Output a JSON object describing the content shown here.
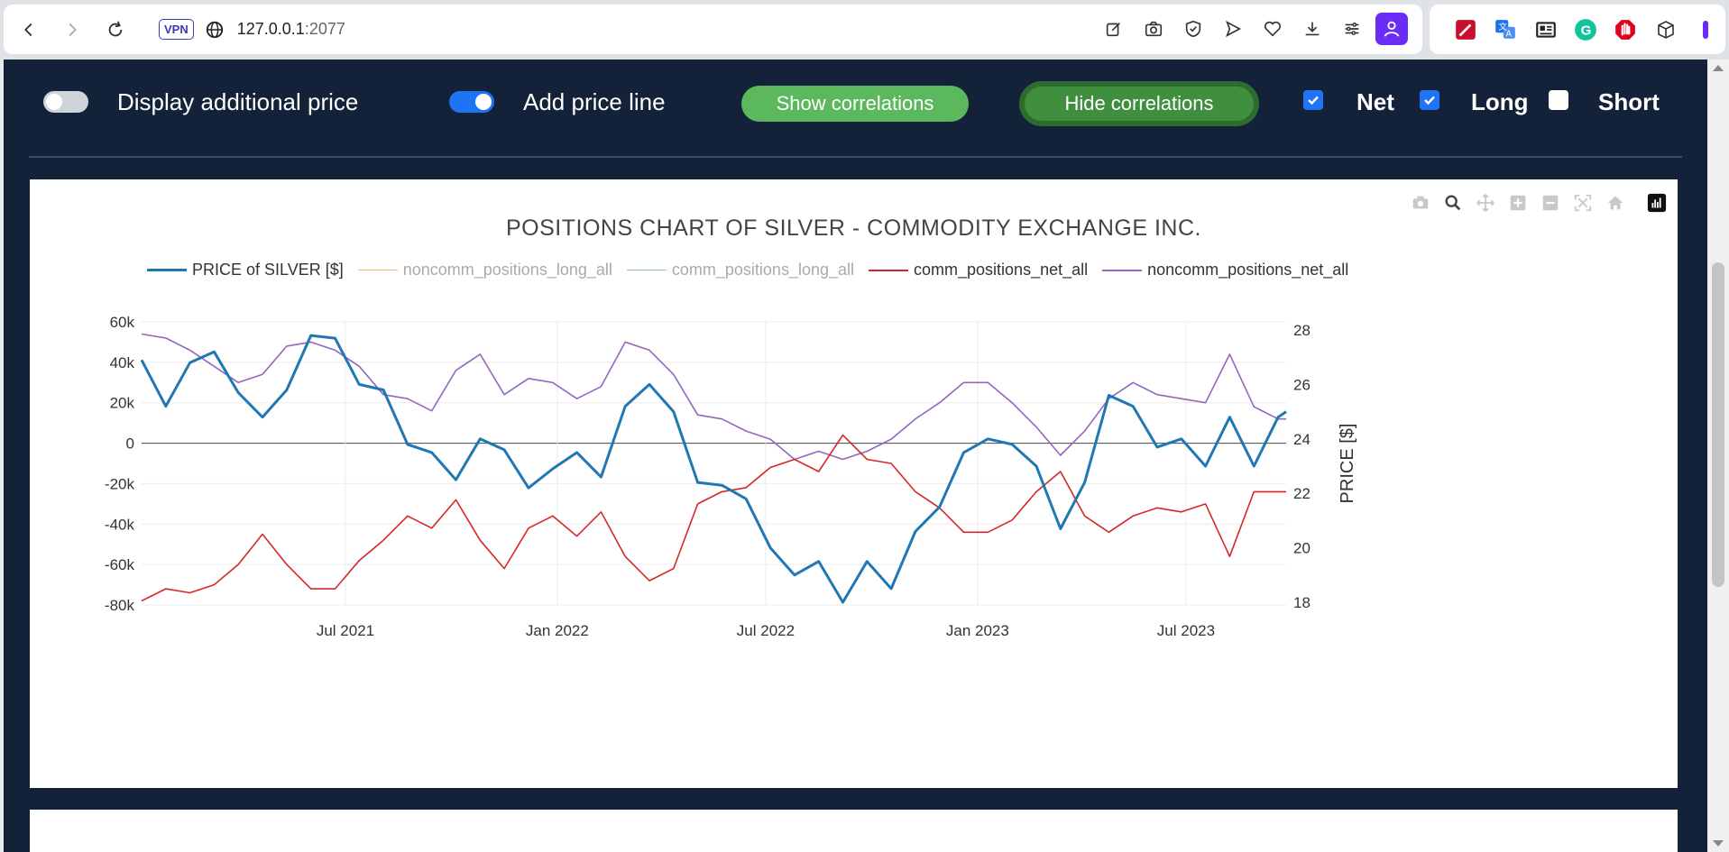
{
  "browser": {
    "url_host": "127.0.0.1",
    "url_port": ":2077",
    "vpn_label": "VPN"
  },
  "controls": {
    "display_additional_price": {
      "label": "Display additional price",
      "on": false
    },
    "add_price_line": {
      "label": "Add price line",
      "on": true
    },
    "show_correlations_label": "Show correlations",
    "hide_correlations_label": "Hide correlations",
    "checkboxes": [
      {
        "label": "Net",
        "checked": true
      },
      {
        "label": "Long",
        "checked": true
      },
      {
        "label": "Short",
        "checked": false
      }
    ]
  },
  "colors": {
    "app_bg": "#132238",
    "price": "#1f77b4",
    "noncomm_long": "#f5b77a",
    "comm_long": "#8cc68c",
    "comm_net": "#d62728",
    "noncomm_net": "#9467bd",
    "button_green": "#5cb85c",
    "checkbox_blue": "#1e74f5"
  },
  "chart_data": {
    "type": "line",
    "title": "POSITIONS CHART OF SILVER - COMMODITY EXCHANGE INC.",
    "y2label": "PRICE [$]",
    "legend": [
      {
        "name": "PRICE of SILVER [$]",
        "color": "#1f77b4",
        "visible": true
      },
      {
        "name": "noncomm_positions_long_all",
        "color": "#f5b77a",
        "visible": false
      },
      {
        "name": "comm_positions_long_all",
        "color": "#8cc68c",
        "visible": false
      },
      {
        "name": "comm_positions_net_all",
        "color": "#d62728",
        "visible": true
      },
      {
        "name": "noncomm_positions_net_all",
        "color": "#9467bd",
        "visible": true
      }
    ],
    "y_ticks": [
      "60k",
      "40k",
      "20k",
      "0",
      "-20k",
      "-40k",
      "-60k",
      "-80k"
    ],
    "y_range": [
      -80000,
      60000
    ],
    "y2_ticks": [
      "28",
      "26",
      "24",
      "22",
      "20",
      "18"
    ],
    "y2_range": [
      17.9,
      28.3
    ],
    "x_ticks": [
      "Jul 2021",
      "Jan 2022",
      "Jul 2022",
      "Jan 2023",
      "Jul 2023"
    ],
    "x_range": [
      "2021-01-05",
      "2023-09-26"
    ],
    "x_tick_dates": [
      "2021-07-01",
      "2022-01-01",
      "2022-07-01",
      "2023-01-01",
      "2023-07-01"
    ],
    "dates": [
      "2021-01-05",
      "2021-01-26",
      "2021-02-16",
      "2021-03-09",
      "2021-03-30",
      "2021-04-20",
      "2021-05-11",
      "2021-06-01",
      "2021-06-22",
      "2021-07-13",
      "2021-08-03",
      "2021-08-24",
      "2021-09-14",
      "2021-10-05",
      "2021-10-26",
      "2021-11-16",
      "2021-12-07",
      "2021-12-28",
      "2022-01-18",
      "2022-02-08",
      "2022-03-01",
      "2022-03-22",
      "2022-04-12",
      "2022-05-03",
      "2022-05-24",
      "2022-06-14",
      "2022-07-05",
      "2022-07-26",
      "2022-08-16",
      "2022-09-06",
      "2022-09-27",
      "2022-10-18",
      "2022-11-08",
      "2022-11-29",
      "2022-12-20",
      "2023-01-10",
      "2023-01-31",
      "2023-02-21",
      "2023-03-14",
      "2023-04-04",
      "2023-04-25",
      "2023-05-16",
      "2023-06-06",
      "2023-06-27",
      "2023-07-18",
      "2023-08-08",
      "2023-08-29",
      "2023-09-19",
      "2023-09-26"
    ],
    "series": [
      {
        "name": "PRICE of SILVER [$]",
        "axis": "y2",
        "values": [
          26.9,
          25.2,
          26.8,
          27.2,
          25.7,
          24.8,
          25.8,
          27.8,
          27.7,
          26.0,
          25.8,
          23.8,
          23.5,
          22.5,
          24.0,
          23.6,
          22.2,
          22.9,
          23.5,
          22.6,
          25.2,
          26.0,
          25.0,
          22.4,
          22.3,
          21.8,
          20.0,
          19.0,
          19.5,
          18.0,
          19.5,
          18.5,
          20.6,
          21.5,
          23.5,
          24.0,
          23.8,
          23.0,
          20.7,
          22.4,
          25.6,
          25.2,
          23.7,
          24.0,
          23.0,
          24.8,
          23.0,
          24.8,
          25.0
        ]
      },
      {
        "name": "comm_positions_net_all",
        "axis": "y",
        "values": [
          -78000,
          -72000,
          -74000,
          -70000,
          -60000,
          -45000,
          -60000,
          -72000,
          -72000,
          -58000,
          -48000,
          -36000,
          -42000,
          -28000,
          -48000,
          -62000,
          -42000,
          -36000,
          -46000,
          -34000,
          -56000,
          -68000,
          -62000,
          -30000,
          -24000,
          -22000,
          -12000,
          -8000,
          -14000,
          4000,
          -8000,
          -10000,
          -24000,
          -32000,
          -44000,
          -44000,
          -38000,
          -24000,
          -14000,
          -36000,
          -44000,
          -36000,
          -32000,
          -34000,
          -30000,
          -56000,
          -24000,
          -24000,
          -24000
        ]
      },
      {
        "name": "noncomm_positions_net_all",
        "axis": "y",
        "values": [
          54000,
          52000,
          46000,
          38000,
          30000,
          34000,
          48000,
          50000,
          46000,
          38000,
          24000,
          22000,
          16000,
          36000,
          44000,
          24000,
          32000,
          30000,
          22000,
          28000,
          50000,
          46000,
          34000,
          14000,
          12000,
          6000,
          2000,
          -8000,
          -4000,
          -8000,
          -4000,
          2000,
          12000,
          20000,
          30000,
          30000,
          20000,
          8000,
          -6000,
          6000,
          22000,
          30000,
          24000,
          22000,
          20000,
          44000,
          18000,
          12000,
          12000
        ]
      }
    ]
  }
}
